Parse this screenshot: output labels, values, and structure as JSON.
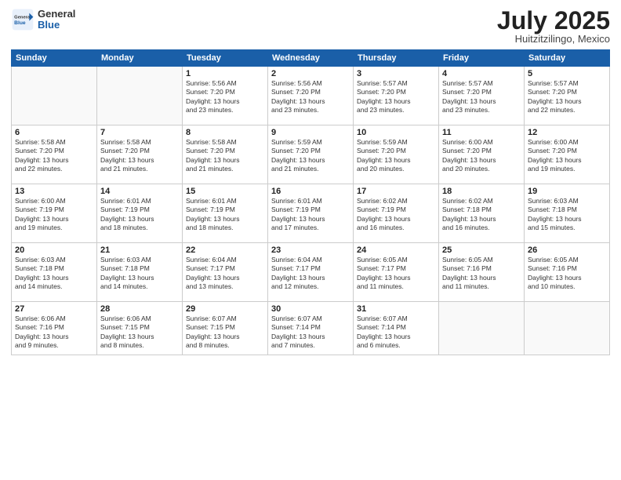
{
  "header": {
    "logo_general": "General",
    "logo_blue": "Blue",
    "month_year": "July 2025",
    "location": "Huitzitzilingo, Mexico"
  },
  "weekdays": [
    "Sunday",
    "Monday",
    "Tuesday",
    "Wednesday",
    "Thursday",
    "Friday",
    "Saturday"
  ],
  "weeks": [
    [
      {
        "day": "",
        "info": ""
      },
      {
        "day": "",
        "info": ""
      },
      {
        "day": "1",
        "info": "Sunrise: 5:56 AM\nSunset: 7:20 PM\nDaylight: 13 hours\nand 23 minutes."
      },
      {
        "day": "2",
        "info": "Sunrise: 5:56 AM\nSunset: 7:20 PM\nDaylight: 13 hours\nand 23 minutes."
      },
      {
        "day": "3",
        "info": "Sunrise: 5:57 AM\nSunset: 7:20 PM\nDaylight: 13 hours\nand 23 minutes."
      },
      {
        "day": "4",
        "info": "Sunrise: 5:57 AM\nSunset: 7:20 PM\nDaylight: 13 hours\nand 23 minutes."
      },
      {
        "day": "5",
        "info": "Sunrise: 5:57 AM\nSunset: 7:20 PM\nDaylight: 13 hours\nand 22 minutes."
      }
    ],
    [
      {
        "day": "6",
        "info": "Sunrise: 5:58 AM\nSunset: 7:20 PM\nDaylight: 13 hours\nand 22 minutes."
      },
      {
        "day": "7",
        "info": "Sunrise: 5:58 AM\nSunset: 7:20 PM\nDaylight: 13 hours\nand 21 minutes."
      },
      {
        "day": "8",
        "info": "Sunrise: 5:58 AM\nSunset: 7:20 PM\nDaylight: 13 hours\nand 21 minutes."
      },
      {
        "day": "9",
        "info": "Sunrise: 5:59 AM\nSunset: 7:20 PM\nDaylight: 13 hours\nand 21 minutes."
      },
      {
        "day": "10",
        "info": "Sunrise: 5:59 AM\nSunset: 7:20 PM\nDaylight: 13 hours\nand 20 minutes."
      },
      {
        "day": "11",
        "info": "Sunrise: 6:00 AM\nSunset: 7:20 PM\nDaylight: 13 hours\nand 20 minutes."
      },
      {
        "day": "12",
        "info": "Sunrise: 6:00 AM\nSunset: 7:20 PM\nDaylight: 13 hours\nand 19 minutes."
      }
    ],
    [
      {
        "day": "13",
        "info": "Sunrise: 6:00 AM\nSunset: 7:19 PM\nDaylight: 13 hours\nand 19 minutes."
      },
      {
        "day": "14",
        "info": "Sunrise: 6:01 AM\nSunset: 7:19 PM\nDaylight: 13 hours\nand 18 minutes."
      },
      {
        "day": "15",
        "info": "Sunrise: 6:01 AM\nSunset: 7:19 PM\nDaylight: 13 hours\nand 18 minutes."
      },
      {
        "day": "16",
        "info": "Sunrise: 6:01 AM\nSunset: 7:19 PM\nDaylight: 13 hours\nand 17 minutes."
      },
      {
        "day": "17",
        "info": "Sunrise: 6:02 AM\nSunset: 7:19 PM\nDaylight: 13 hours\nand 16 minutes."
      },
      {
        "day": "18",
        "info": "Sunrise: 6:02 AM\nSunset: 7:18 PM\nDaylight: 13 hours\nand 16 minutes."
      },
      {
        "day": "19",
        "info": "Sunrise: 6:03 AM\nSunset: 7:18 PM\nDaylight: 13 hours\nand 15 minutes."
      }
    ],
    [
      {
        "day": "20",
        "info": "Sunrise: 6:03 AM\nSunset: 7:18 PM\nDaylight: 13 hours\nand 14 minutes."
      },
      {
        "day": "21",
        "info": "Sunrise: 6:03 AM\nSunset: 7:18 PM\nDaylight: 13 hours\nand 14 minutes."
      },
      {
        "day": "22",
        "info": "Sunrise: 6:04 AM\nSunset: 7:17 PM\nDaylight: 13 hours\nand 13 minutes."
      },
      {
        "day": "23",
        "info": "Sunrise: 6:04 AM\nSunset: 7:17 PM\nDaylight: 13 hours\nand 12 minutes."
      },
      {
        "day": "24",
        "info": "Sunrise: 6:05 AM\nSunset: 7:17 PM\nDaylight: 13 hours\nand 11 minutes."
      },
      {
        "day": "25",
        "info": "Sunrise: 6:05 AM\nSunset: 7:16 PM\nDaylight: 13 hours\nand 11 minutes."
      },
      {
        "day": "26",
        "info": "Sunrise: 6:05 AM\nSunset: 7:16 PM\nDaylight: 13 hours\nand 10 minutes."
      }
    ],
    [
      {
        "day": "27",
        "info": "Sunrise: 6:06 AM\nSunset: 7:16 PM\nDaylight: 13 hours\nand 9 minutes."
      },
      {
        "day": "28",
        "info": "Sunrise: 6:06 AM\nSunset: 7:15 PM\nDaylight: 13 hours\nand 8 minutes."
      },
      {
        "day": "29",
        "info": "Sunrise: 6:07 AM\nSunset: 7:15 PM\nDaylight: 13 hours\nand 8 minutes."
      },
      {
        "day": "30",
        "info": "Sunrise: 6:07 AM\nSunset: 7:14 PM\nDaylight: 13 hours\nand 7 minutes."
      },
      {
        "day": "31",
        "info": "Sunrise: 6:07 AM\nSunset: 7:14 PM\nDaylight: 13 hours\nand 6 minutes."
      },
      {
        "day": "",
        "info": ""
      },
      {
        "day": "",
        "info": ""
      }
    ]
  ]
}
